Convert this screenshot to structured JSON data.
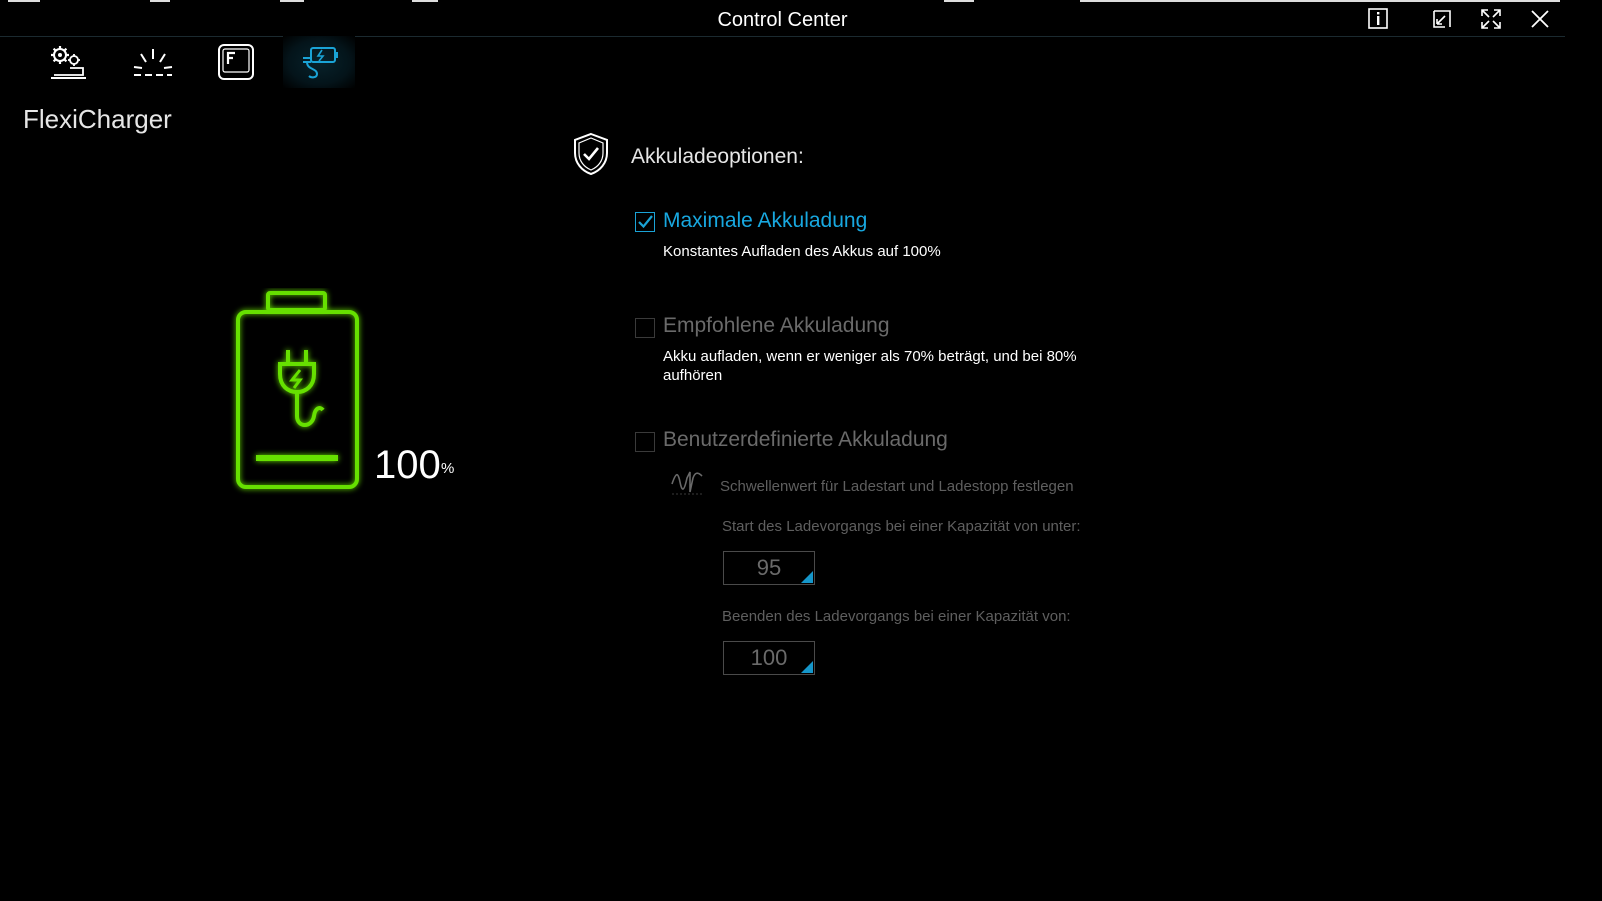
{
  "window": {
    "title": "Control Center"
  },
  "tabs": [
    {
      "name": "system-settings",
      "icon": "gear-laptop-icon",
      "active": false
    },
    {
      "name": "lighting",
      "icon": "light-rays-icon",
      "active": false
    },
    {
      "name": "function-key",
      "icon": "f-key-icon",
      "active": false
    },
    {
      "name": "flexicharger",
      "icon": "battery-plug-icon",
      "active": true
    }
  ],
  "page": {
    "title": "FlexiCharger",
    "battery_percent_value": "100",
    "battery_percent_unit": "%"
  },
  "options": {
    "heading": "Akkuladeoptionen:",
    "items": [
      {
        "label": "Maximale Akkuladung",
        "description": "Konstantes Aufladen des Akkus auf 100%",
        "checked": true
      },
      {
        "label": "Empfohlene Akkuladung",
        "description": "Akku aufladen, wenn er weniger als 70% beträgt, und bei 80% aufhören",
        "checked": false
      },
      {
        "label": "Benutzerdefinierte Akkuladung",
        "checked": false
      }
    ],
    "custom": {
      "threshold_text": "Schwellenwert für Ladestart und Ladestopp festlegen",
      "start_label": "Start des Ladevorgangs bei einer Kapazität von unter:",
      "start_value": "95",
      "stop_label": "Beenden des Ladevorgangs bei einer Kapazität von:",
      "stop_value": "100"
    }
  },
  "colors": {
    "accent": "#18a8e0",
    "battery_green": "#66e000",
    "background": "#000000"
  }
}
